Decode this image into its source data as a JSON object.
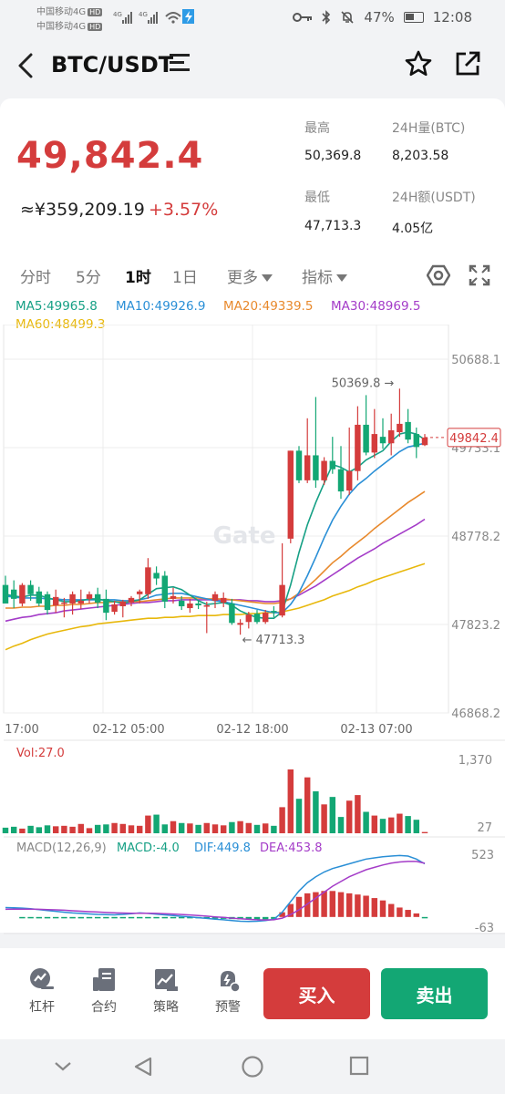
{
  "status": {
    "carrier1": "中国移动4G",
    "carrier2": "中国移动4G",
    "hd": "HD",
    "battery": "47%",
    "time": "12:08"
  },
  "header": {
    "pair": "BTC/USDT"
  },
  "price": {
    "last": "49,842.4",
    "cny": "≈¥359,209.19",
    "change": "+3.57%"
  },
  "stats": {
    "high_label": "最高",
    "high_value": "50,369.8",
    "vol_label": "24H量(BTC)",
    "vol_value": "8,203.58",
    "low_label": "最低",
    "low_value": "47,713.3",
    "amt_label": "24H额(USDT)",
    "amt_value": "4.05亿"
  },
  "tabs": {
    "t1": "分时",
    "t2": "5分",
    "t3": "1时",
    "t4": "1日",
    "t5": "更多",
    "t6": "指标"
  },
  "ma": {
    "ma5": "MA5:49965.8",
    "ma10": "MA10:49926.9",
    "ma20": "MA20:49339.5",
    "ma30": "MA30:48969.5",
    "ma60": "MA60:48499.3"
  },
  "colors": {
    "up": "#d43c3c",
    "down": "#13a774",
    "ma5": "#16a085",
    "ma10": "#2a8fd6",
    "ma20": "#e8892c",
    "ma30": "#a43cc8",
    "ma60": "#e8b80c"
  },
  "chart_data": {
    "type": "candlestick",
    "y_ticks": [
      "50688.1",
      "49733.1",
      "48778.2",
      "47823.2",
      "46868.2"
    ],
    "ylim": [
      46868.2,
      50688.1
    ],
    "x_ticks": [
      "17:00",
      "02-12 05:00",
      "02-12 18:00",
      "02-13 07:00"
    ],
    "last_price_tag": "49842.4",
    "high_annotation": "50369.8",
    "low_annotation": "47713.3",
    "watermark": "Gate",
    "candles": [
      {
        "o": 48250,
        "h": 48350,
        "l": 48050,
        "c": 48050
      },
      {
        "o": 48200,
        "h": 48300,
        "l": 48000,
        "c": 48100
      },
      {
        "o": 48050,
        "h": 48270,
        "l": 48020,
        "c": 48250
      },
      {
        "o": 48250,
        "h": 48300,
        "l": 48080,
        "c": 48150
      },
      {
        "o": 48180,
        "h": 48230,
        "l": 48020,
        "c": 48050
      },
      {
        "o": 48150,
        "h": 48180,
        "l": 47930,
        "c": 47980
      },
      {
        "o": 48030,
        "h": 48200,
        "l": 47950,
        "c": 48120
      },
      {
        "o": 48050,
        "h": 48110,
        "l": 47900,
        "c": 48060
      },
      {
        "o": 48050,
        "h": 48180,
        "l": 47930,
        "c": 48150
      },
      {
        "o": 48050,
        "h": 48200,
        "l": 47990,
        "c": 48080
      },
      {
        "o": 48100,
        "h": 48180,
        "l": 48050,
        "c": 48150
      },
      {
        "o": 48150,
        "h": 48220,
        "l": 48000,
        "c": 48060
      },
      {
        "o": 48100,
        "h": 48200,
        "l": 47870,
        "c": 47950
      },
      {
        "o": 47960,
        "h": 48080,
        "l": 47930,
        "c": 48040
      },
      {
        "o": 48020,
        "h": 48090,
        "l": 47900,
        "c": 48070
      },
      {
        "o": 48060,
        "h": 48130,
        "l": 48020,
        "c": 48110
      },
      {
        "o": 48150,
        "h": 48200,
        "l": 48050,
        "c": 48180
      },
      {
        "o": 48150,
        "h": 48540,
        "l": 48100,
        "c": 48440
      },
      {
        "o": 48380,
        "h": 48450,
        "l": 48250,
        "c": 48320
      },
      {
        "o": 48350,
        "h": 48400,
        "l": 48000,
        "c": 48070
      },
      {
        "o": 48100,
        "h": 48220,
        "l": 48050,
        "c": 48130
      },
      {
        "o": 48080,
        "h": 48130,
        "l": 47980,
        "c": 48020
      },
      {
        "o": 48000,
        "h": 48100,
        "l": 47950,
        "c": 48050
      },
      {
        "o": 48050,
        "h": 48080,
        "l": 47990,
        "c": 48030
      },
      {
        "o": 48030,
        "h": 48070,
        "l": 47730,
        "c": 48030
      },
      {
        "o": 48080,
        "h": 48180,
        "l": 48000,
        "c": 48150
      },
      {
        "o": 48060,
        "h": 48170,
        "l": 48010,
        "c": 48110
      },
      {
        "o": 48050,
        "h": 48100,
        "l": 47820,
        "c": 47840
      },
      {
        "o": 47820,
        "h": 47880,
        "l": 47713,
        "c": 47840
      },
      {
        "o": 47850,
        "h": 47960,
        "l": 47780,
        "c": 47930
      },
      {
        "o": 47940,
        "h": 47980,
        "l": 47830,
        "c": 47850
      },
      {
        "o": 47850,
        "h": 47980,
        "l": 47830,
        "c": 47950
      },
      {
        "o": 47970,
        "h": 48020,
        "l": 47900,
        "c": 47960
      },
      {
        "o": 47920,
        "h": 48700,
        "l": 47900,
        "c": 48250
      },
      {
        "o": 48750,
        "h": 49700,
        "l": 48700,
        "c": 49700
      },
      {
        "o": 49700,
        "h": 49750,
        "l": 49350,
        "c": 49380
      },
      {
        "o": 49380,
        "h": 50050,
        "l": 49350,
        "c": 49650
      },
      {
        "o": 49650,
        "h": 50280,
        "l": 49300,
        "c": 49380
      },
      {
        "o": 49380,
        "h": 49630,
        "l": 49330,
        "c": 49590
      },
      {
        "o": 49590,
        "h": 49850,
        "l": 49450,
        "c": 49500
      },
      {
        "o": 49500,
        "h": 49750,
        "l": 49180,
        "c": 49260
      },
      {
        "o": 49270,
        "h": 49950,
        "l": 49220,
        "c": 49480
      },
      {
        "o": 49480,
        "h": 50180,
        "l": 49380,
        "c": 49980
      },
      {
        "o": 49980,
        "h": 50300,
        "l": 49650,
        "c": 49680
      },
      {
        "o": 49680,
        "h": 50150,
        "l": 49620,
        "c": 49880
      },
      {
        "o": 49850,
        "h": 50050,
        "l": 49720,
        "c": 49780
      },
      {
        "o": 49780,
        "h": 50100,
        "l": 49650,
        "c": 49920
      },
      {
        "o": 49900,
        "h": 50370,
        "l": 49850,
        "c": 49990
      },
      {
        "o": 50010,
        "h": 50150,
        "l": 49780,
        "c": 49820
      },
      {
        "o": 49880,
        "h": 49950,
        "l": 49620,
        "c": 49740
      },
      {
        "o": 49760,
        "h": 49880,
        "l": 49750,
        "c": 49842
      }
    ],
    "ma_series": {
      "ma5": [
        48150,
        48130,
        48120,
        48140,
        48140,
        48110,
        48090,
        48070,
        48070,
        48080,
        48100,
        48100,
        48080,
        48070,
        48050,
        48070,
        48090,
        48150,
        48210,
        48220,
        48230,
        48200,
        48140,
        48080,
        48040,
        48050,
        48060,
        48030,
        47970,
        47930,
        47900,
        47890,
        47890,
        47960,
        48250,
        48600,
        48900,
        49140,
        49350,
        49550,
        49520,
        49470,
        49520,
        49600,
        49650,
        49700,
        49800,
        49880,
        49900,
        49880,
        49820
      ],
      "ma10": [
        48130,
        48120,
        48110,
        48110,
        48110,
        48100,
        48100,
        48090,
        48090,
        48090,
        48090,
        48090,
        48090,
        48090,
        48080,
        48080,
        48090,
        48110,
        48140,
        48150,
        48160,
        48160,
        48140,
        48120,
        48100,
        48080,
        48070,
        48050,
        48030,
        48010,
        47990,
        47970,
        47950,
        47950,
        48040,
        48170,
        48350,
        48550,
        48760,
        48950,
        49100,
        49230,
        49330,
        49400,
        49480,
        49550,
        49620,
        49690,
        49740,
        49760,
        49780
      ],
      "ma20": [
        48000,
        48000,
        48010,
        48010,
        48020,
        48020,
        48030,
        48030,
        48040,
        48040,
        48050,
        48060,
        48060,
        48070,
        48070,
        48070,
        48070,
        48080,
        48090,
        48100,
        48110,
        48110,
        48110,
        48110,
        48100,
        48100,
        48100,
        48090,
        48080,
        48070,
        48060,
        48050,
        48050,
        48060,
        48100,
        48160,
        48230,
        48310,
        48400,
        48490,
        48560,
        48640,
        48710,
        48780,
        48860,
        48930,
        49000,
        49070,
        49140,
        49200,
        49260
      ],
      "ma30": [
        47860,
        47880,
        47900,
        47910,
        47930,
        47940,
        47950,
        47970,
        47980,
        47990,
        48000,
        48010,
        48020,
        48030,
        48040,
        48050,
        48060,
        48060,
        48070,
        48080,
        48080,
        48090,
        48090,
        48090,
        48090,
        48090,
        48090,
        48090,
        48090,
        48080,
        48080,
        48070,
        48070,
        48080,
        48100,
        48140,
        48190,
        48240,
        48300,
        48360,
        48420,
        48480,
        48540,
        48590,
        48640,
        48700,
        48750,
        48800,
        48850,
        48900,
        48960
      ],
      "ma60": [
        47550,
        47590,
        47620,
        47660,
        47690,
        47720,
        47740,
        47760,
        47780,
        47800,
        47810,
        47830,
        47840,
        47850,
        47860,
        47870,
        47880,
        47890,
        47890,
        47900,
        47900,
        47910,
        47910,
        47920,
        47920,
        47920,
        47930,
        47930,
        47930,
        47940,
        47940,
        47950,
        47950,
        47960,
        47980,
        48000,
        48030,
        48060,
        48090,
        48130,
        48160,
        48190,
        48230,
        48260,
        48300,
        48330,
        48360,
        48390,
        48420,
        48450,
        48480
      ]
    },
    "volume_label": "Vol:27.0",
    "volume_ticks": [
      "1,370",
      "27"
    ],
    "volume_max": 1370,
    "volume": [
      120,
      140,
      100,
      160,
      130,
      170,
      150,
      160,
      140,
      200,
      110,
      180,
      190,
      220,
      200,
      170,
      160,
      380,
      400,
      190,
      260,
      220,
      210,
      180,
      220,
      190,
      170,
      240,
      260,
      220,
      180,
      210,
      160,
      560,
      1370,
      740,
      1200,
      900,
      620,
      780,
      350,
      700,
      820,
      460,
      380,
      310,
      340,
      420,
      370,
      290,
      27
    ],
    "macd_label": "MACD(12,26,9)",
    "macd_value": "MACD:-4.0",
    "dif_value": "DIF:449.8",
    "dea_value": "DEA:453.8",
    "macd_ticks": [
      "523",
      "-63"
    ],
    "macd_ylim": [
      -63,
      523
    ],
    "macd_hist": [
      0,
      0,
      -8,
      -10,
      -12,
      -12,
      -10,
      -10,
      -12,
      -12,
      -10,
      -10,
      -8,
      -6,
      -8,
      -8,
      -6,
      -4,
      -3,
      -2,
      -4,
      -6,
      -8,
      -10,
      -12,
      -14,
      -16,
      -18,
      -20,
      -22,
      -22,
      -20,
      -16,
      40,
      110,
      170,
      200,
      210,
      220,
      220,
      210,
      200,
      190,
      180,
      160,
      140,
      110,
      80,
      60,
      30,
      -4
    ],
    "dif": [
      80,
      78,
      75,
      70,
      62,
      55,
      48,
      40,
      34,
      30,
      26,
      22,
      20,
      18,
      22,
      28,
      34,
      30,
      24,
      18,
      12,
      6,
      0,
      -6,
      -12,
      -18,
      -24,
      -30,
      -36,
      -38,
      -36,
      -30,
      -20,
      40,
      130,
      220,
      290,
      340,
      380,
      410,
      430,
      450,
      470,
      490,
      500,
      510,
      515,
      520,
      515,
      490,
      450
    ],
    "dea": [
      65,
      66,
      66,
      66,
      65,
      63,
      60,
      57,
      53,
      49,
      45,
      42,
      38,
      35,
      33,
      32,
      32,
      32,
      30,
      28,
      25,
      21,
      17,
      12,
      7,
      1,
      -4,
      -10,
      -15,
      -20,
      -24,
      -25,
      -24,
      -10,
      20,
      60,
      110,
      160,
      210,
      260,
      300,
      340,
      370,
      400,
      420,
      440,
      455,
      465,
      470,
      470,
      454
    ]
  },
  "bottom": {
    "leverage": "杠杆",
    "contract": "合约",
    "strategy": "策略",
    "alert": "预警",
    "buy": "买入",
    "sell": "卖出"
  }
}
